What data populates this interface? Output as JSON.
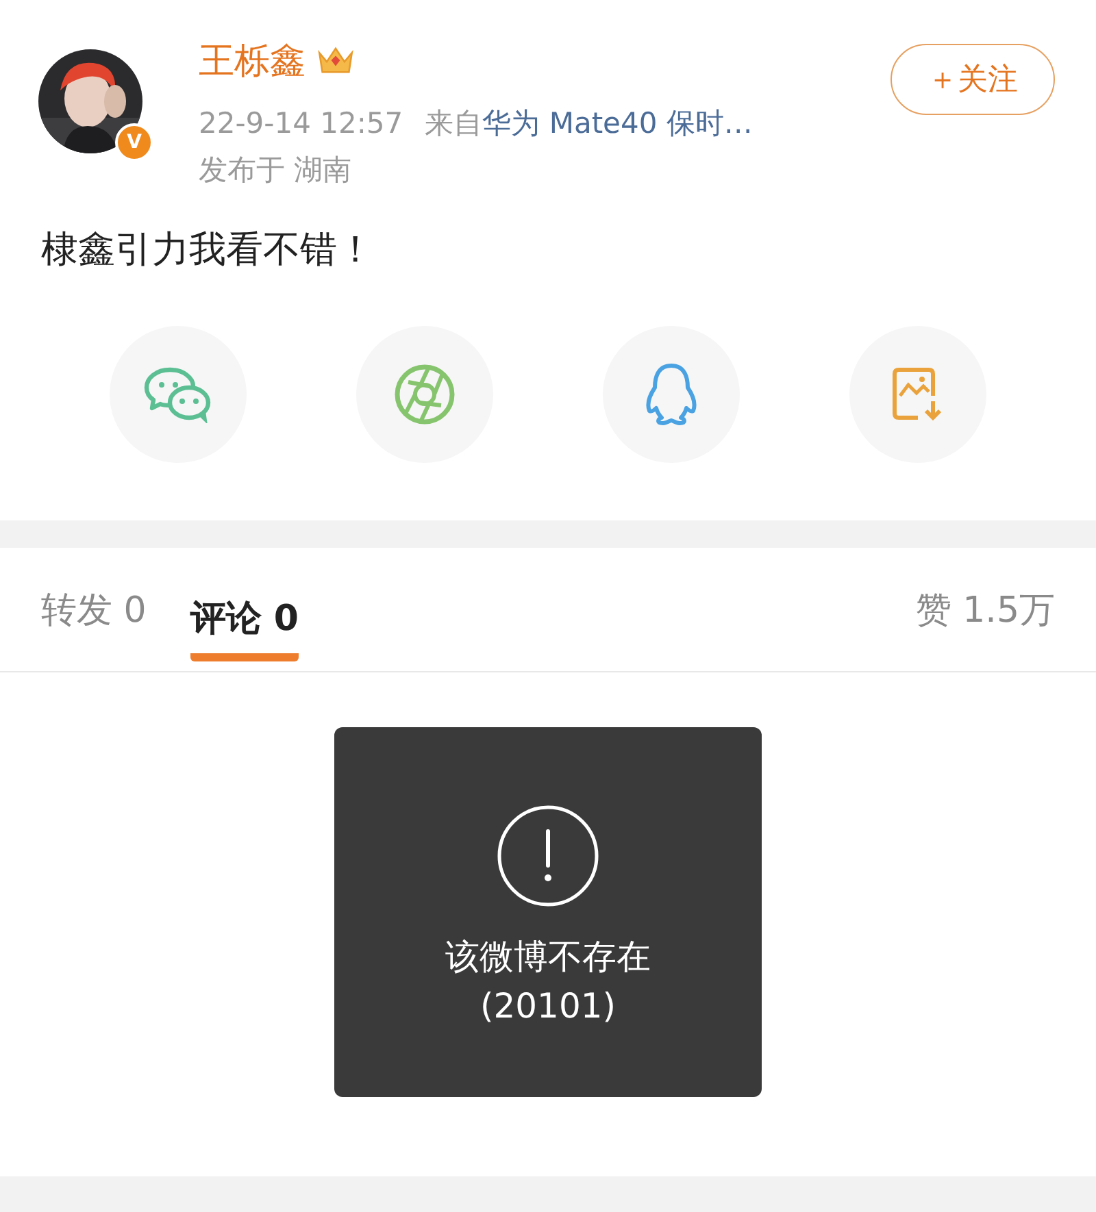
{
  "post": {
    "author": "王栎鑫",
    "verified_badge": "V",
    "time": "22-9-14 12:57",
    "source_prefix": "来自",
    "source": "华为 Mate40 保时…",
    "location": "发布于 湖南",
    "follow_button": "＋关注",
    "text": "棣鑫引力我看不错！"
  },
  "share_targets": [
    {
      "kind": "chat"
    },
    {
      "kind": "aperture"
    },
    {
      "kind": "penguin"
    },
    {
      "kind": "save-image"
    }
  ],
  "tabs": [
    {
      "label": "转发",
      "count": "0",
      "selected": false
    },
    {
      "label": "评论",
      "count": "0",
      "selected": true
    }
  ],
  "likes": {
    "label": "赞",
    "count": "1.5万"
  },
  "toast": {
    "message": "该微博不存在",
    "code": "(20101)"
  }
}
